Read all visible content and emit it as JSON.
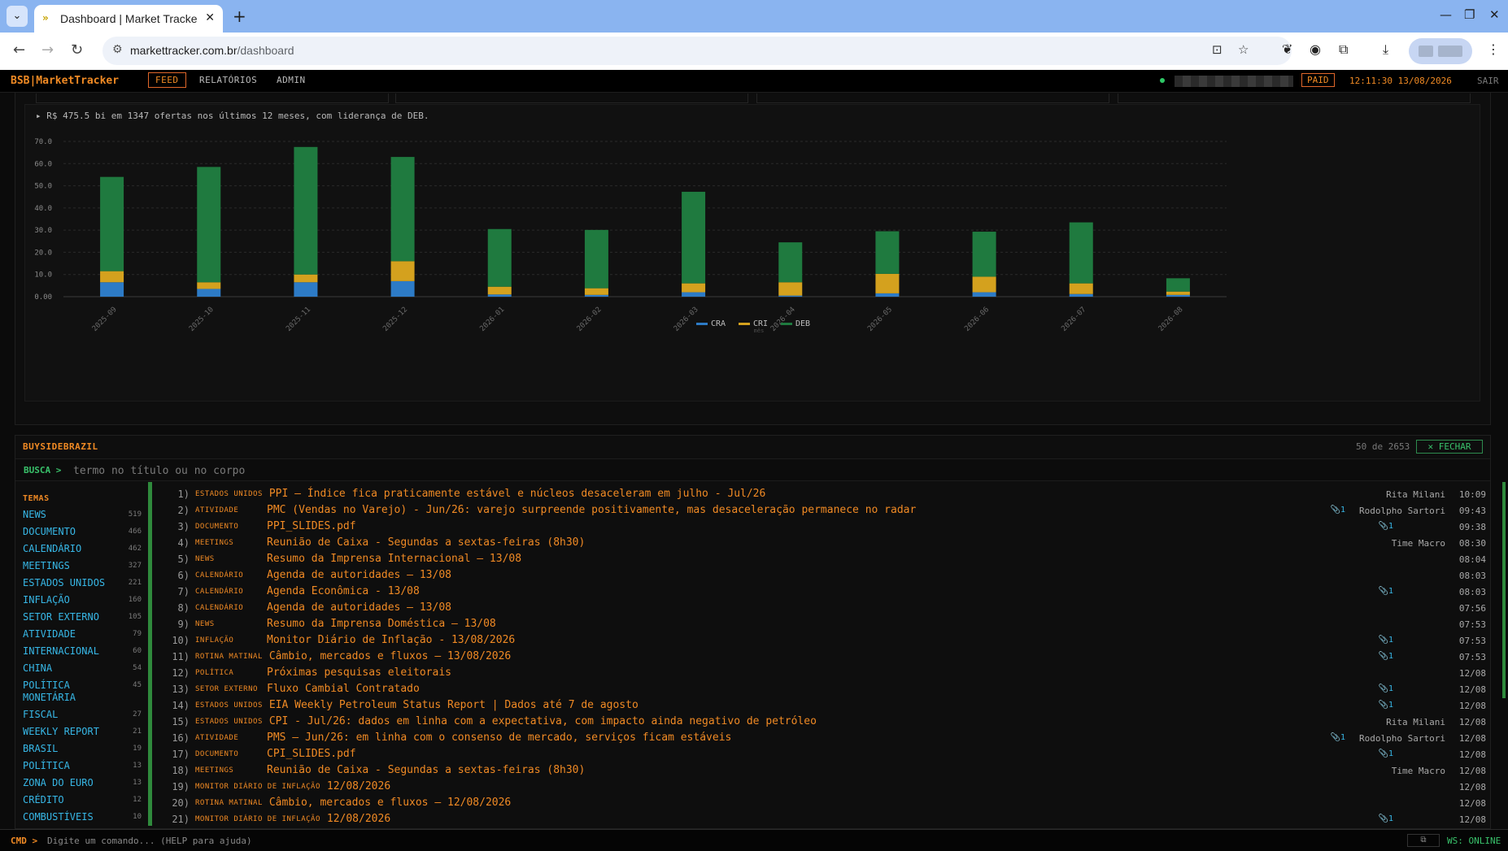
{
  "browser": {
    "tab_title": "Dashboard | Market Tracker",
    "tab_favicon": "»",
    "close_tab": "✕",
    "new_tab": "+",
    "url_domain": "markettracker.com.br",
    "url_path": "/dashboard"
  },
  "header": {
    "brand": "BSB|MarketTracker",
    "nav": [
      "FEED",
      "RELATÓRIOS",
      "ADMIN"
    ],
    "active_nav": "FEED",
    "paid_badge": "PAID",
    "clock": "12:11:30 13/08/2026",
    "logout": "SAIR"
  },
  "chart_summary": "▸ R$ 475.5 bi em 1347 ofertas nos últimos 12 meses, com liderança de DEB.",
  "chart_data": {
    "type": "bar",
    "stacked": true,
    "categories": [
      "2025-09",
      "2025-10",
      "2025-11",
      "2025-12",
      "2026-01",
      "2026-02",
      "2026-03",
      "2026-04",
      "2026-05",
      "2026-06",
      "2026-07",
      "2026-08"
    ],
    "series": [
      {
        "name": "CRA",
        "color": "#2d7bc6",
        "values": [
          6.5,
          3.5,
          6.5,
          7.0,
          1.0,
          0.8,
          2.0,
          0.5,
          1.5,
          2.0,
          1.2,
          0.8
        ]
      },
      {
        "name": "CRI",
        "color": "#d4a11e",
        "values": [
          5.0,
          3.0,
          3.5,
          9.0,
          3.5,
          3.0,
          4.0,
          6.0,
          8.8,
          7.0,
          4.8,
          1.5
        ]
      },
      {
        "name": "DEB",
        "color": "#1f7a3f",
        "values": [
          42.5,
          52.0,
          57.5,
          47.0,
          26.0,
          26.3,
          41.3,
          18.0,
          19.2,
          20.3,
          27.5,
          6.0
        ]
      }
    ],
    "y_ticks": [
      "0.00",
      "10.0",
      "20.0",
      "30.0",
      "40.0",
      "50.0",
      "60.0",
      "70.0"
    ],
    "ylim": [
      0,
      70
    ],
    "grid": true,
    "legend_position": "bottom-center",
    "x_axis_label": "mês"
  },
  "feed": {
    "title": "BUYSIDEBRAZIL",
    "count": "50 de 2653",
    "close_label": "✕ FECHAR",
    "search_prompt": "BUSCA >",
    "search_placeholder": "termo no título ou no corpo",
    "topics_title": "TEMAS",
    "topics": [
      {
        "name": "NEWS",
        "count": "519"
      },
      {
        "name": "DOCUMENTO",
        "count": "466"
      },
      {
        "name": "CALENDÁRIO",
        "count": "462"
      },
      {
        "name": "MEETINGS",
        "count": "327"
      },
      {
        "name": "ESTADOS UNIDOS",
        "count": "221"
      },
      {
        "name": "INFLAÇÃO",
        "count": "160"
      },
      {
        "name": "SETOR EXTERNO",
        "count": "105"
      },
      {
        "name": "ATIVIDADE",
        "count": "79"
      },
      {
        "name": "INTERNACIONAL",
        "count": "60"
      },
      {
        "name": "CHINA",
        "count": "54"
      },
      {
        "name": "POLÍTICA MONETÁRIA",
        "count": "45"
      },
      {
        "name": "FISCAL",
        "count": "27"
      },
      {
        "name": "WEEKLY REPORT",
        "count": "21"
      },
      {
        "name": "BRASIL",
        "count": "19"
      },
      {
        "name": "POLÍTICA",
        "count": "13"
      },
      {
        "name": "ZONA DO EURO",
        "count": "13"
      },
      {
        "name": "CRÉDITO",
        "count": "12"
      },
      {
        "name": "COMBUSTÍVEIS",
        "count": "10"
      }
    ],
    "items": [
      {
        "n": "1)",
        "cat": "ESTADOS UNIDOS",
        "title": "PPI – Índice fica praticamente estável e núcleos desaceleram em julho - Jul/26",
        "attach": "",
        "author": "Rita Milani",
        "time": "10:09"
      },
      {
        "n": "2)",
        "cat": "ATIVIDADE",
        "title": "PMC (Vendas no Varejo) - Jun/26: varejo surpreende positivamente, mas desaceleração permanece no radar",
        "attach": "📎1",
        "author": "Rodolpho Sartori",
        "time": "09:43"
      },
      {
        "n": "3)",
        "cat": "DOCUMENTO",
        "title": "PPI_SLIDES.pdf",
        "attach": "📎1",
        "author": "",
        "time": "09:38"
      },
      {
        "n": "4)",
        "cat": "MEETINGS",
        "title": "Reunião de Caixa - Segundas a sextas-feiras (8h30)",
        "attach": "",
        "author": "Time Macro",
        "time": "08:30"
      },
      {
        "n": "5)",
        "cat": "NEWS",
        "title": "Resumo da Imprensa Internacional – 13/08",
        "attach": "",
        "author": "",
        "time": "08:04"
      },
      {
        "n": "6)",
        "cat": "CALENDÁRIO",
        "title": "Agenda de autoridades – 13/08",
        "attach": "",
        "author": "",
        "time": "08:03"
      },
      {
        "n": "7)",
        "cat": "CALENDÁRIO",
        "title": "Agenda Econômica - 13/08",
        "attach": "📎1",
        "author": "",
        "time": "08:03"
      },
      {
        "n": "8)",
        "cat": "CALENDÁRIO",
        "title": "Agenda de autoridades – 13/08",
        "attach": "",
        "author": "",
        "time": "07:56"
      },
      {
        "n": "9)",
        "cat": "NEWS",
        "title": "Resumo da Imprensa Doméstica – 13/08",
        "attach": "",
        "author": "",
        "time": "07:53"
      },
      {
        "n": "10)",
        "cat": "INFLAÇÃO",
        "title": "Monitor Diário de Inflação - 13/08/2026",
        "attach": "📎1",
        "author": "",
        "time": "07:53"
      },
      {
        "n": "11)",
        "cat": "ROTINA MATINAL",
        "title": "Câmbio, mercados e fluxos — 13/08/2026",
        "attach": "📎1",
        "author": "",
        "time": "07:53"
      },
      {
        "n": "12)",
        "cat": "POLÍTICA",
        "title": "Próximas pesquisas eleitorais",
        "attach": "",
        "author": "",
        "time": "12/08"
      },
      {
        "n": "13)",
        "cat": "SETOR EXTERNO",
        "title": "Fluxo Cambial Contratado",
        "attach": "📎1",
        "author": "",
        "time": "12/08"
      },
      {
        "n": "14)",
        "cat": "ESTADOS UNIDOS",
        "title": "EIA Weekly Petroleum Status Report | Dados até 7 de agosto",
        "attach": "📎1",
        "author": "",
        "time": "12/08"
      },
      {
        "n": "15)",
        "cat": "ESTADOS UNIDOS",
        "title": "CPI - Jul/26: dados em linha com a expectativa, com impacto ainda negativo de petróleo",
        "attach": "",
        "author": "Rita Milani",
        "time": "12/08"
      },
      {
        "n": "16)",
        "cat": "ATIVIDADE",
        "title": "PMS – Jun/26: em linha com o consenso de mercado, serviços ficam estáveis",
        "attach": "📎1",
        "author": "Rodolpho Sartori",
        "time": "12/08"
      },
      {
        "n": "17)",
        "cat": "DOCUMENTO",
        "title": "CPI_SLIDES.pdf",
        "attach": "📎1",
        "author": "",
        "time": "12/08"
      },
      {
        "n": "18)",
        "cat": "MEETINGS",
        "title": "Reunião de Caixa - Segundas a sextas-feiras (8h30)",
        "attach": "",
        "author": "Time Macro",
        "time": "12/08"
      },
      {
        "n": "19)",
        "cat": "MONITOR DIÁRIO DE INFLAÇÃO",
        "title": "12/08/2026",
        "attach": "",
        "author": "",
        "time": "12/08"
      },
      {
        "n": "20)",
        "cat": "ROTINA MATINAL",
        "title": "Câmbio, mercados e fluxos — 12/08/2026",
        "attach": "",
        "author": "",
        "time": "12/08"
      },
      {
        "n": "21)",
        "cat": "MONITOR DIÁRIO DE INFLAÇÃO",
        "title": "12/08/2026",
        "attach": "📎1",
        "author": "",
        "time": "12/08"
      }
    ]
  },
  "cmd": {
    "label": "CMD >",
    "placeholder": "Digite um comando... (HELP para ajuda)",
    "copy_icon": "⧉",
    "ws_status": "WS: ONLINE"
  },
  "colors": {
    "accent": "#f08a24",
    "link": "#37b7e6",
    "online": "#39c26b"
  }
}
